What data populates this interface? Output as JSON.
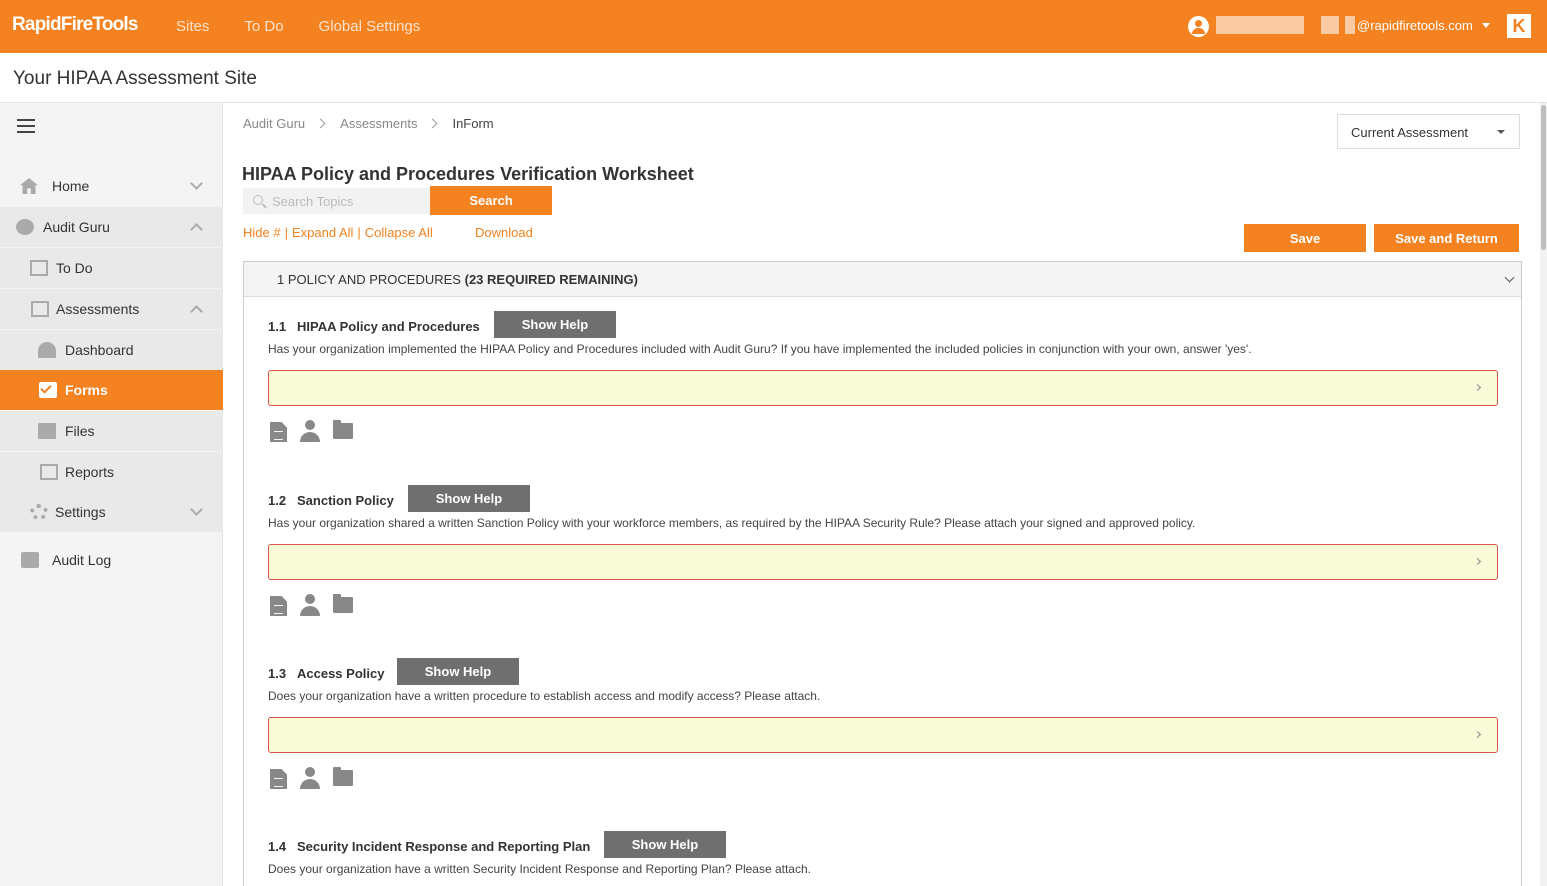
{
  "topbar": {
    "logo": "RapidFireTools",
    "nav": [
      "Sites",
      "To Do",
      "Global Settings"
    ],
    "user_email": "@rapidfiretools.com",
    "k_logo": "K"
  },
  "site_title": "Your HIPAA Assessment Site",
  "sidebar": {
    "home": "Home",
    "audit_guru": "Audit Guru",
    "todo": "To Do",
    "assessments": "Assessments",
    "dashboard": "Dashboard",
    "forms": "Forms",
    "files": "Files",
    "reports": "Reports",
    "settings": "Settings",
    "audit_log": "Audit Log"
  },
  "breadcrumb": [
    "Audit Guru",
    "Assessments",
    "InForm"
  ],
  "assessment_select": "Current Assessment",
  "page_title": "HIPAA Policy and Procedures Verification Worksheet",
  "search": {
    "placeholder": "Search Topics",
    "button": "Search"
  },
  "links": {
    "hide": "Hide #",
    "expand": "Expand All",
    "collapse": "Collapse All",
    "download": "Download"
  },
  "buttons": {
    "save": "Save",
    "save_return": "Save and Return"
  },
  "section": {
    "title": "1 POLICY AND PROCEDURES",
    "remaining": "(23 REQUIRED REMAINING)"
  },
  "help_label": "Show Help",
  "questions": [
    {
      "num": "1.1",
      "name": "HIPAA Policy and Procedures",
      "text": "Has your organization implemented the HIPAA Policy and Procedures included with Audit Guru? If you have implemented the included policies in conjunction with your own, answer 'yes'."
    },
    {
      "num": "1.2",
      "name": "Sanction Policy",
      "text": "Has your organization shared a written Sanction Policy with your workforce members, as required by the HIPAA Security Rule? Please attach your signed and approved policy."
    },
    {
      "num": "1.3",
      "name": "Access Policy",
      "text": "Does your organization have a written procedure to establish access and modify access? Please attach."
    },
    {
      "num": "1.4",
      "name": "Security Incident Response and Reporting Plan",
      "text": "Does your organization have a written Security Incident Response and Reporting Plan? Please attach."
    }
  ],
  "colors": {
    "brand": "#f58220",
    "answer_bg": "#f9fbd9",
    "answer_border": "#d9534f",
    "help_button": "#6f6f6f"
  }
}
